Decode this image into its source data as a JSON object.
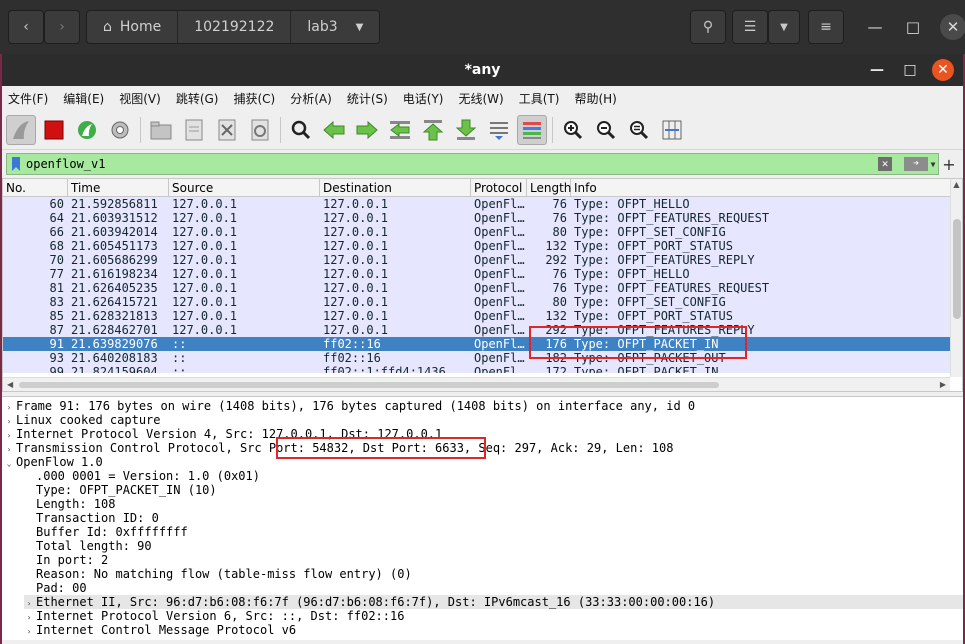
{
  "filemanager": {
    "crumbs": [
      "Home",
      "102192122",
      "lab3"
    ]
  },
  "window": {
    "title": "*any"
  },
  "menu": [
    "文件(F)",
    "编辑(E)",
    "视图(V)",
    "跳转(G)",
    "捕获(C)",
    "分析(A)",
    "统计(S)",
    "电话(Y)",
    "无线(W)",
    "工具(T)",
    "帮助(H)"
  ],
  "filter": {
    "value": "openflow_v1"
  },
  "columns": [
    "No.",
    "Time",
    "Source",
    "Destination",
    "Protocol",
    "Length",
    "Info"
  ],
  "packets": [
    {
      "no": "60",
      "time": "21.592856811",
      "src": "127.0.0.1",
      "dst": "127.0.0.1",
      "proto": "OpenFl…",
      "len": "76",
      "info": "Type: OFPT_HELLO"
    },
    {
      "no": "64",
      "time": "21.603931512",
      "src": "127.0.0.1",
      "dst": "127.0.0.1",
      "proto": "OpenFl…",
      "len": "76",
      "info": "Type: OFPT_FEATURES_REQUEST"
    },
    {
      "no": "66",
      "time": "21.603942014",
      "src": "127.0.0.1",
      "dst": "127.0.0.1",
      "proto": "OpenFl…",
      "len": "80",
      "info": "Type: OFPT_SET_CONFIG"
    },
    {
      "no": "68",
      "time": "21.605451173",
      "src": "127.0.0.1",
      "dst": "127.0.0.1",
      "proto": "OpenFl…",
      "len": "132",
      "info": "Type: OFPT_PORT_STATUS"
    },
    {
      "no": "70",
      "time": "21.605686299",
      "src": "127.0.0.1",
      "dst": "127.0.0.1",
      "proto": "OpenFl…",
      "len": "292",
      "info": "Type: OFPT_FEATURES_REPLY"
    },
    {
      "no": "77",
      "time": "21.616198234",
      "src": "127.0.0.1",
      "dst": "127.0.0.1",
      "proto": "OpenFl…",
      "len": "76",
      "info": "Type: OFPT_HELLO"
    },
    {
      "no": "81",
      "time": "21.626405235",
      "src": "127.0.0.1",
      "dst": "127.0.0.1",
      "proto": "OpenFl…",
      "len": "76",
      "info": "Type: OFPT_FEATURES_REQUEST"
    },
    {
      "no": "83",
      "time": "21.626415721",
      "src": "127.0.0.1",
      "dst": "127.0.0.1",
      "proto": "OpenFl…",
      "len": "80",
      "info": "Type: OFPT_SET_CONFIG"
    },
    {
      "no": "85",
      "time": "21.628321813",
      "src": "127.0.0.1",
      "dst": "127.0.0.1",
      "proto": "OpenFl…",
      "len": "132",
      "info": "Type: OFPT_PORT_STATUS"
    },
    {
      "no": "87",
      "time": "21.628462701",
      "src": "127.0.0.1",
      "dst": "127.0.0.1",
      "proto": "OpenFl…",
      "len": "292",
      "info": "Type: OFPT_FEATURES_REPLY"
    },
    {
      "no": "91",
      "time": "21.639829076",
      "src": "::",
      "dst": "ff02::16",
      "proto": "OpenFl…",
      "len": "176",
      "info": "Type: OFPT_PACKET_IN",
      "selected": true
    },
    {
      "no": "93",
      "time": "21.640208183",
      "src": "::",
      "dst": "ff02::16",
      "proto": "OpenFl…",
      "len": "182",
      "info": "Type: OFPT_PACKET_OUT"
    },
    {
      "no": "99",
      "time": "21.824159604",
      "src": "::",
      "dst": "ff02::1:ffd4:1436",
      "proto": "OpenFl…",
      "len": "172",
      "info": "Type: OFPT_PACKET_IN"
    }
  ],
  "details": [
    {
      "text": "Frame 91: 176 bytes on wire (1408 bits), 176 bytes captured (1408 bits) on interface any, id 0",
      "tw": "›",
      "indent": 0
    },
    {
      "text": "Linux cooked capture",
      "tw": "›",
      "indent": 0
    },
    {
      "text": "Internet Protocol Version 4, Src: 127.0.0.1, Dst: 127.0.0.1",
      "tw": "›",
      "indent": 0
    },
    {
      "text": "Transmission Control Protocol, Src Port: 54832, Dst Port: 6633, Seq: 297, Ack: 29, Len: 108",
      "tw": "›",
      "indent": 0
    },
    {
      "text": "OpenFlow 1.0",
      "tw": "⌄",
      "indent": 0
    },
    {
      "text": ".000 0001 = Version: 1.0 (0x01)",
      "tw": "",
      "indent": 1
    },
    {
      "text": "Type: OFPT_PACKET_IN (10)",
      "tw": "",
      "indent": 1
    },
    {
      "text": "Length: 108",
      "tw": "",
      "indent": 1
    },
    {
      "text": "Transaction ID: 0",
      "tw": "",
      "indent": 1
    },
    {
      "text": "Buffer Id: 0xffffffff",
      "tw": "",
      "indent": 1
    },
    {
      "text": "Total length: 90",
      "tw": "",
      "indent": 1
    },
    {
      "text": "In port: 2",
      "tw": "",
      "indent": 1
    },
    {
      "text": "Reason: No matching flow (table-miss flow entry) (0)",
      "tw": "",
      "indent": 1
    },
    {
      "text": "Pad: 00",
      "tw": "",
      "indent": 1
    },
    {
      "text": "Ethernet II, Src: 96:d7:b6:08:f6:7f (96:d7:b6:08:f6:7f), Dst: IPv6mcast_16 (33:33:00:00:00:16)",
      "tw": "›",
      "indent": 1,
      "hl": true
    },
    {
      "text": "Internet Protocol Version 6, Src: ::, Dst: ff02::16",
      "tw": "›",
      "indent": 1
    },
    {
      "text": "Internet Control Message Protocol v6",
      "tw": "›",
      "indent": 1
    }
  ],
  "colors": {
    "row_bg": "#e7e6ff",
    "row_selected": "#3e82c4",
    "filter_valid": "#a6e99f",
    "annotation": "#e1262a"
  }
}
